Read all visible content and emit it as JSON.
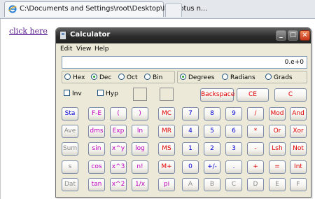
{
  "browser": {
    "tab_title": "C:\\Documents and Settings\\root\\Desktop\\IBM lotus n..."
  },
  "page": {
    "link_text": "click here"
  },
  "calculator": {
    "title": "Calculator",
    "window_buttons": {
      "minimize": "_",
      "maximize": "□",
      "close": "✕"
    },
    "menu": [
      "Edit",
      "View",
      "Help"
    ],
    "display_value": "0.e+0",
    "base_radios": [
      {
        "label": "Hex",
        "selected": false
      },
      {
        "label": "Dec",
        "selected": true
      },
      {
        "label": "Oct",
        "selected": false
      },
      {
        "label": "Bin",
        "selected": false
      }
    ],
    "angle_radios": [
      {
        "label": "Degrees",
        "selected": true
      },
      {
        "label": "Radians",
        "selected": false
      },
      {
        "label": "Grads",
        "selected": false
      }
    ],
    "checkboxes": [
      "Inv",
      "Hyp"
    ],
    "edit_buttons": [
      "Backspace",
      "CE",
      "C"
    ],
    "rows": [
      [
        "Sta",
        "F-E",
        "(",
        ")",
        "MC",
        "7",
        "8",
        "9",
        "/",
        "Mod",
        "And"
      ],
      [
        "Ave",
        "dms",
        "Exp",
        "ln",
        "MR",
        "4",
        "5",
        "6",
        "*",
        "Or",
        "Xor"
      ],
      [
        "Sum",
        "sin",
        "x^y",
        "log",
        "MS",
        "1",
        "2",
        "3",
        "-",
        "Lsh",
        "Not"
      ],
      [
        "s",
        "cos",
        "x^3",
        "n!",
        "M+",
        "0",
        "+/-",
        ".",
        "+",
        "=",
        "Int"
      ],
      [
        "Dat",
        "tan",
        "x^2",
        "1/x",
        "pi",
        "A",
        "B",
        "C",
        "D",
        "E",
        "F"
      ]
    ],
    "colors": {
      "digits": "#0000d6",
      "operators": "#e00000",
      "functions": "#c000c0",
      "disabled": "#8a8a8a"
    }
  }
}
